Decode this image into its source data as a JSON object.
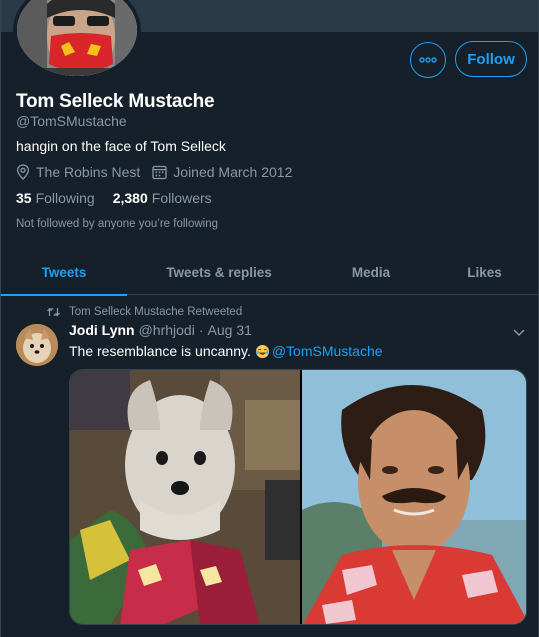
{
  "profile": {
    "name": "Tom Selleck Mustache",
    "handle": "@TomSMustache",
    "bio": "hangin on the face of Tom Selleck",
    "location": "The Robins Nest",
    "joined": "Joined March 2012",
    "following_count": "35",
    "following_label": "Following",
    "followers_count": "2,380",
    "followers_label": "Followers",
    "followed_by_note": "Not followed by anyone you’re following",
    "follow_label": "Follow"
  },
  "tabs": [
    {
      "label": "Tweets",
      "active": true
    },
    {
      "label": "Tweets & replies",
      "active": false
    },
    {
      "label": "Media",
      "active": false
    },
    {
      "label": "Likes",
      "active": false
    }
  ],
  "tweet": {
    "retweet_label": "Tom Selleck Mustache Retweeted",
    "author": "Jodi Lynn",
    "handle": "@hrhjodi",
    "separator": "·",
    "date": "Aug 31",
    "text": "The resemblance is uncanny.",
    "mention": "@TomSMustache"
  },
  "colors": {
    "background": "#15202b",
    "accent": "#1da1f2",
    "secondary_text": "#8899a6",
    "border": "#38444d"
  },
  "icons": [
    "more-icon",
    "location-icon",
    "calendar-icon",
    "retweet-icon",
    "chevron-down-icon",
    "tears-of-joy-emoji"
  ]
}
